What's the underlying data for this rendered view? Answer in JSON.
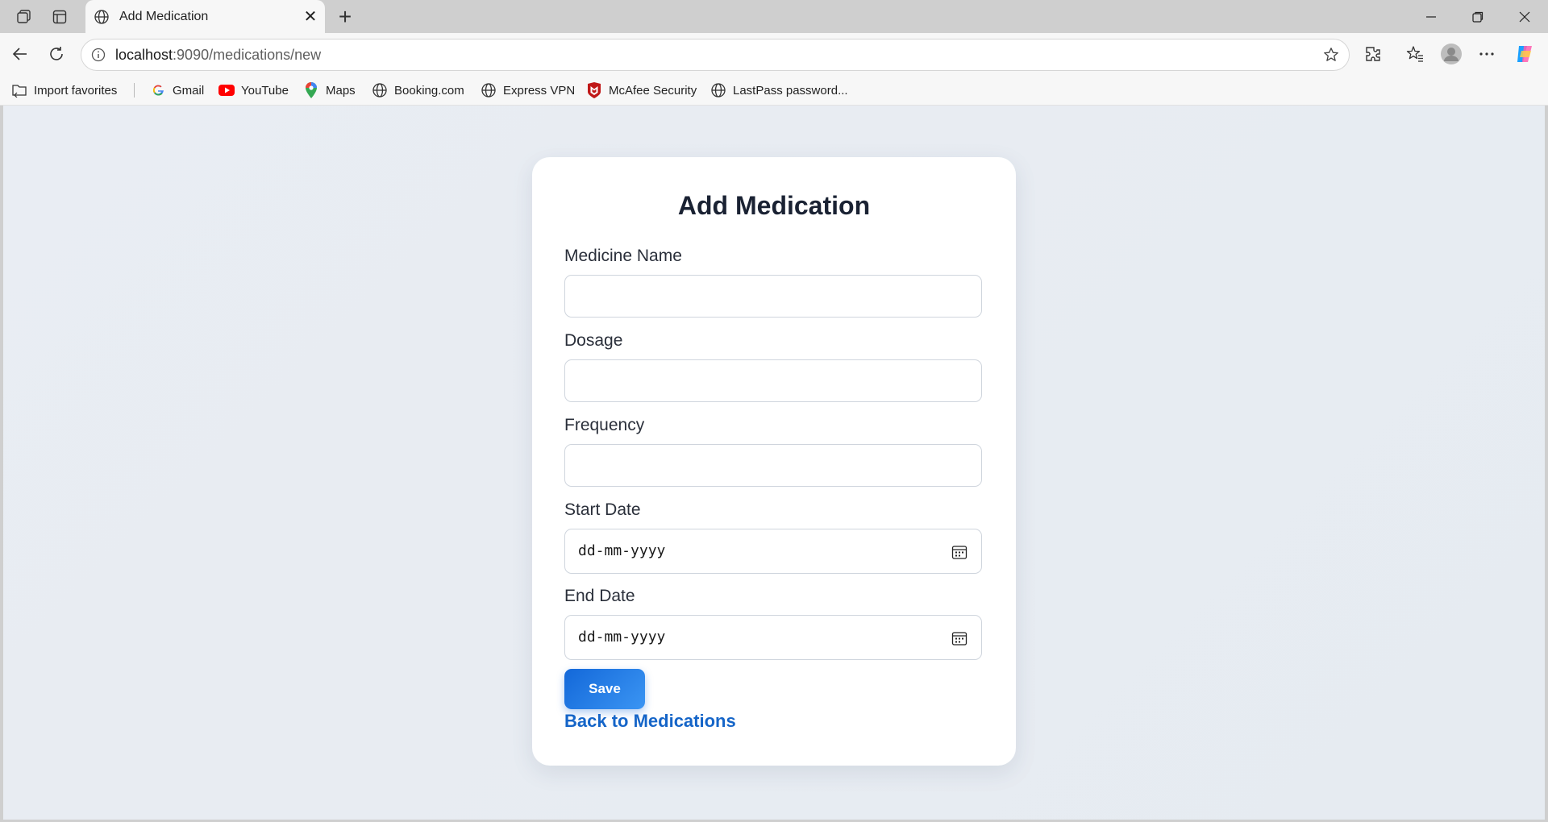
{
  "browser": {
    "tab_title": "Add Medication",
    "url_host": "localhost",
    "url_path": ":9090/medications/new",
    "bookmarks": [
      {
        "label": "Import favorites",
        "icon": "import-icon"
      },
      {
        "label": "Gmail",
        "icon": "google-icon"
      },
      {
        "label": "YouTube",
        "icon": "youtube-icon"
      },
      {
        "label": "Maps",
        "icon": "maps-icon"
      },
      {
        "label": "Booking.com",
        "icon": "globe-icon"
      },
      {
        "label": "Express VPN",
        "icon": "globe-icon"
      },
      {
        "label": "McAfee Security",
        "icon": "mcafee-icon"
      },
      {
        "label": "LastPass password...",
        "icon": "globe-icon"
      }
    ]
  },
  "form": {
    "title": "Add Medication",
    "fields": [
      {
        "label": "Medicine Name",
        "value": ""
      },
      {
        "label": "Dosage",
        "value": ""
      },
      {
        "label": "Frequency",
        "value": ""
      },
      {
        "label": "Start Date",
        "placeholder": "dd-mm-yyyy"
      },
      {
        "label": "End Date",
        "placeholder": "dd-mm-yyyy"
      }
    ],
    "save_label": "Save",
    "back_label": "Back to Medications"
  },
  "colors": {
    "accent": "#1368d9",
    "link": "#1565c8",
    "page_bg": "#e9edf3"
  }
}
